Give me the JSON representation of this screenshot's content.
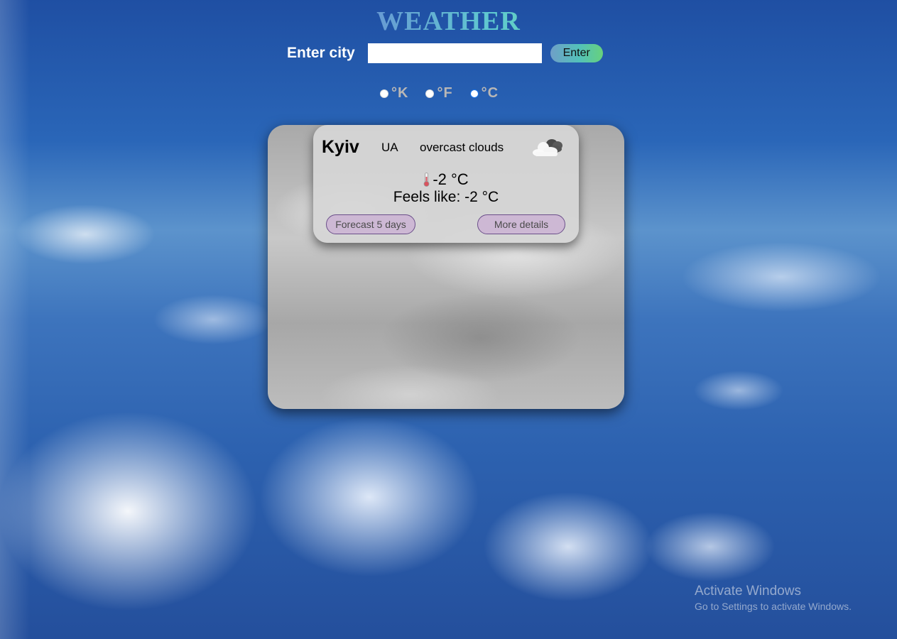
{
  "header": {
    "title": "WEATHER"
  },
  "search": {
    "label": "Enter city",
    "value": "",
    "placeholder": "",
    "button_label": "Enter"
  },
  "units": [
    {
      "label": "°K",
      "selected": false
    },
    {
      "label": "°F",
      "selected": false
    },
    {
      "label": "°C",
      "selected": true
    }
  ],
  "card": {
    "city": "Kyiv",
    "country": "UA",
    "description": "overcast clouds",
    "weather_icon": "cloud-icon",
    "temperature": "-2 °C",
    "feels_like": "Feels like: -2 °C",
    "forecast_button": "Forecast 5 days",
    "details_button": "More details"
  },
  "watermark": {
    "title": "Activate Windows",
    "subtitle": "Go to Settings to activate Windows."
  }
}
